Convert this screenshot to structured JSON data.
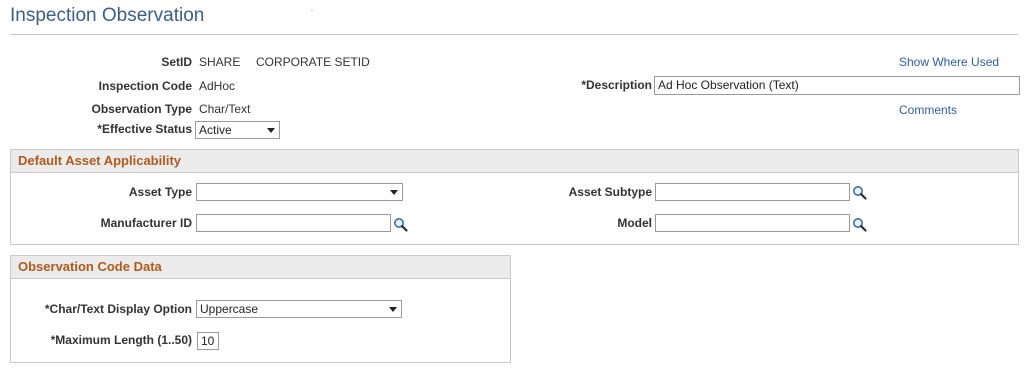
{
  "page": {
    "title": "Inspection Observation"
  },
  "header": {
    "setid_label": "SetID",
    "setid_value": "SHARE",
    "setid_desc": "CORPORATE SETID",
    "inspection_code_label": "Inspection Code",
    "inspection_code_value": "AdHoc",
    "observation_type_label": "Observation Type",
    "observation_type_value": "Char/Text",
    "effective_status_label": "*Effective Status",
    "effective_status_value": "Active",
    "description_label": "*Description",
    "description_value": "Ad Hoc Observation (Text)",
    "show_where_used": "Show Where Used",
    "comments": "Comments"
  },
  "asset_section": {
    "title": "Default Asset Applicability",
    "asset_type_label": "Asset Type",
    "asset_type_value": "",
    "asset_subtype_label": "Asset Subtype",
    "asset_subtype_value": "",
    "manufacturer_label": "Manufacturer ID",
    "manufacturer_value": "",
    "model_label": "Model",
    "model_value": ""
  },
  "observation_section": {
    "title": "Observation Code Data",
    "display_option_label": "*Char/Text Display Option",
    "display_option_value": "Uppercase",
    "max_length_label": "*Maximum Length (1..50)",
    "max_length_value": "10"
  },
  "colors": {
    "title": "#3b5d8a",
    "section_title": "#b05a1e",
    "link": "#2a5db0"
  },
  "icons": {
    "lookup": "magnifier-icon",
    "dropdown": "chevron-down-icon"
  }
}
